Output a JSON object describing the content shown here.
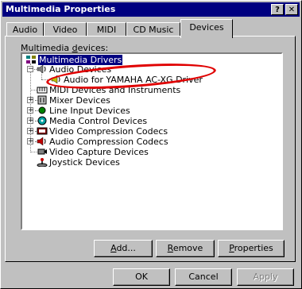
{
  "window": {
    "title": "Multimedia Properties",
    "help_label": "?",
    "close_label": "✕"
  },
  "tabs": [
    {
      "label": "Audio"
    },
    {
      "label": "Video"
    },
    {
      "label": "MIDI"
    },
    {
      "label": "CD Music"
    },
    {
      "label": "Devices",
      "active": true
    }
  ],
  "devices_label": {
    "before": "Multimedia ",
    "mnemonic": "d",
    "after": "evices:"
  },
  "tree": {
    "root": "Multimedia Drivers",
    "audio_devices": "Audio Devices",
    "yamaha_driver": "Audio for YAMAHA AC-XG Driver",
    "midi": "MIDI Devices and Instruments",
    "mixer": "Mixer Devices",
    "line_input": "Line Input Devices",
    "media_control": "Media Control Devices",
    "video_codecs": "Video Compression Codecs",
    "audio_codecs": "Audio Compression Codecs",
    "video_capture": "Video Capture Devices",
    "joystick": "Joystick Devices"
  },
  "panel_buttons": {
    "add": {
      "mnemonic": "A",
      "rest": "dd..."
    },
    "remove": {
      "mnemonic": "R",
      "rest": "emove"
    },
    "properties": {
      "mnemonic": "P",
      "rest": "roperties"
    }
  },
  "dialog_buttons": {
    "ok": "OK",
    "cancel": "Cancel",
    "apply": "Apply"
  },
  "colors": {
    "selection": "#000080",
    "highlight_ring": "#e00000",
    "title_bar": "#000080"
  }
}
